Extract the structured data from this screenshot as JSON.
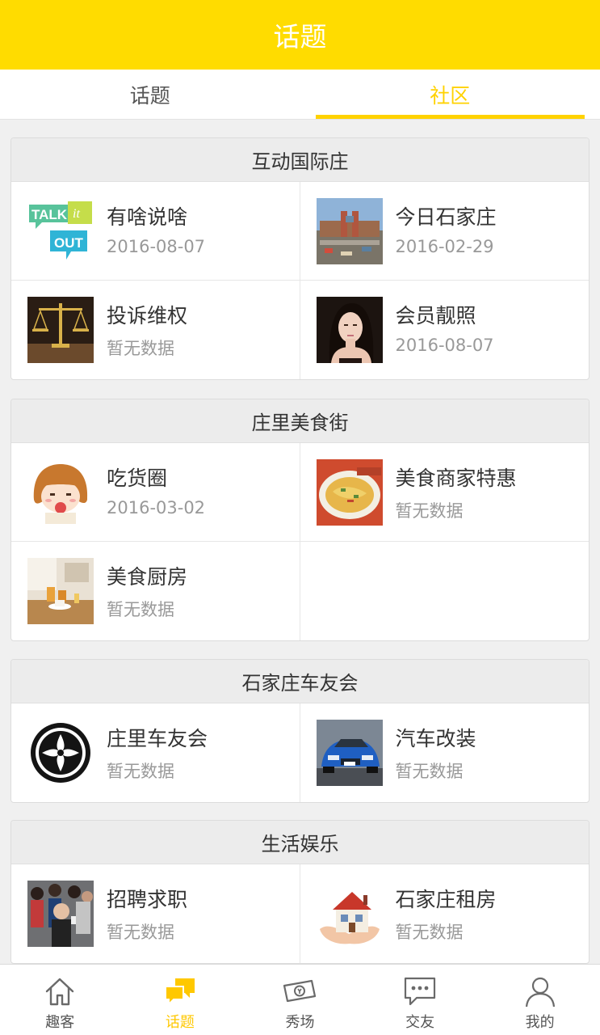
{
  "header": {
    "title": "话题"
  },
  "tabs": [
    {
      "label": "话题",
      "active": false
    },
    {
      "label": "社区",
      "active": true
    }
  ],
  "sections": [
    {
      "title": "互动国际庄",
      "items": [
        {
          "name": "有啥说啥",
          "sub": "2016-08-07",
          "thumb": "talk-it-out-image"
        },
        {
          "name": "今日石家庄",
          "sub": "2016-02-29",
          "thumb": "railway-station-image"
        },
        {
          "name": "投诉维权",
          "sub": "暂无数据",
          "thumb": "scales-of-justice-image"
        },
        {
          "name": "会员靓照",
          "sub": "2016-08-07",
          "thumb": "woman-portrait-image"
        }
      ]
    },
    {
      "title": "庄里美食街",
      "items": [
        {
          "name": "吃货圈",
          "sub": "2016-03-02",
          "thumb": "cartoon-girl-image"
        },
        {
          "name": "美食商家特惠",
          "sub": "暂无数据",
          "thumb": "food-plate-image"
        },
        {
          "name": "美食厨房",
          "sub": "暂无数据",
          "thumb": "kitchen-table-image"
        }
      ]
    },
    {
      "title": "石家庄车友会",
      "items": [
        {
          "name": "庄里车友会",
          "sub": "暂无数据",
          "thumb": "car-club-emblem-image"
        },
        {
          "name": "汽车改装",
          "sub": "暂无数据",
          "thumb": "blue-car-image"
        }
      ]
    },
    {
      "title": "生活娱乐",
      "items": [
        {
          "name": "招聘求职",
          "sub": "暂无数据",
          "thumb": "job-crowd-image"
        },
        {
          "name": "石家庄租房",
          "sub": "暂无数据",
          "thumb": "house-in-hands-image"
        }
      ]
    }
  ],
  "bottom_nav": [
    {
      "label": "趣客",
      "icon": "home-icon",
      "active": false
    },
    {
      "label": "话题",
      "icon": "chat-bubbles-icon",
      "active": true
    },
    {
      "label": "秀场",
      "icon": "money-show-icon",
      "active": false
    },
    {
      "label": "交友",
      "icon": "message-dots-icon",
      "active": false
    },
    {
      "label": "我的",
      "icon": "user-icon",
      "active": false
    }
  ],
  "colors": {
    "accent": "#ffdc00",
    "active_text": "#ffd200",
    "muted": "#999999"
  }
}
